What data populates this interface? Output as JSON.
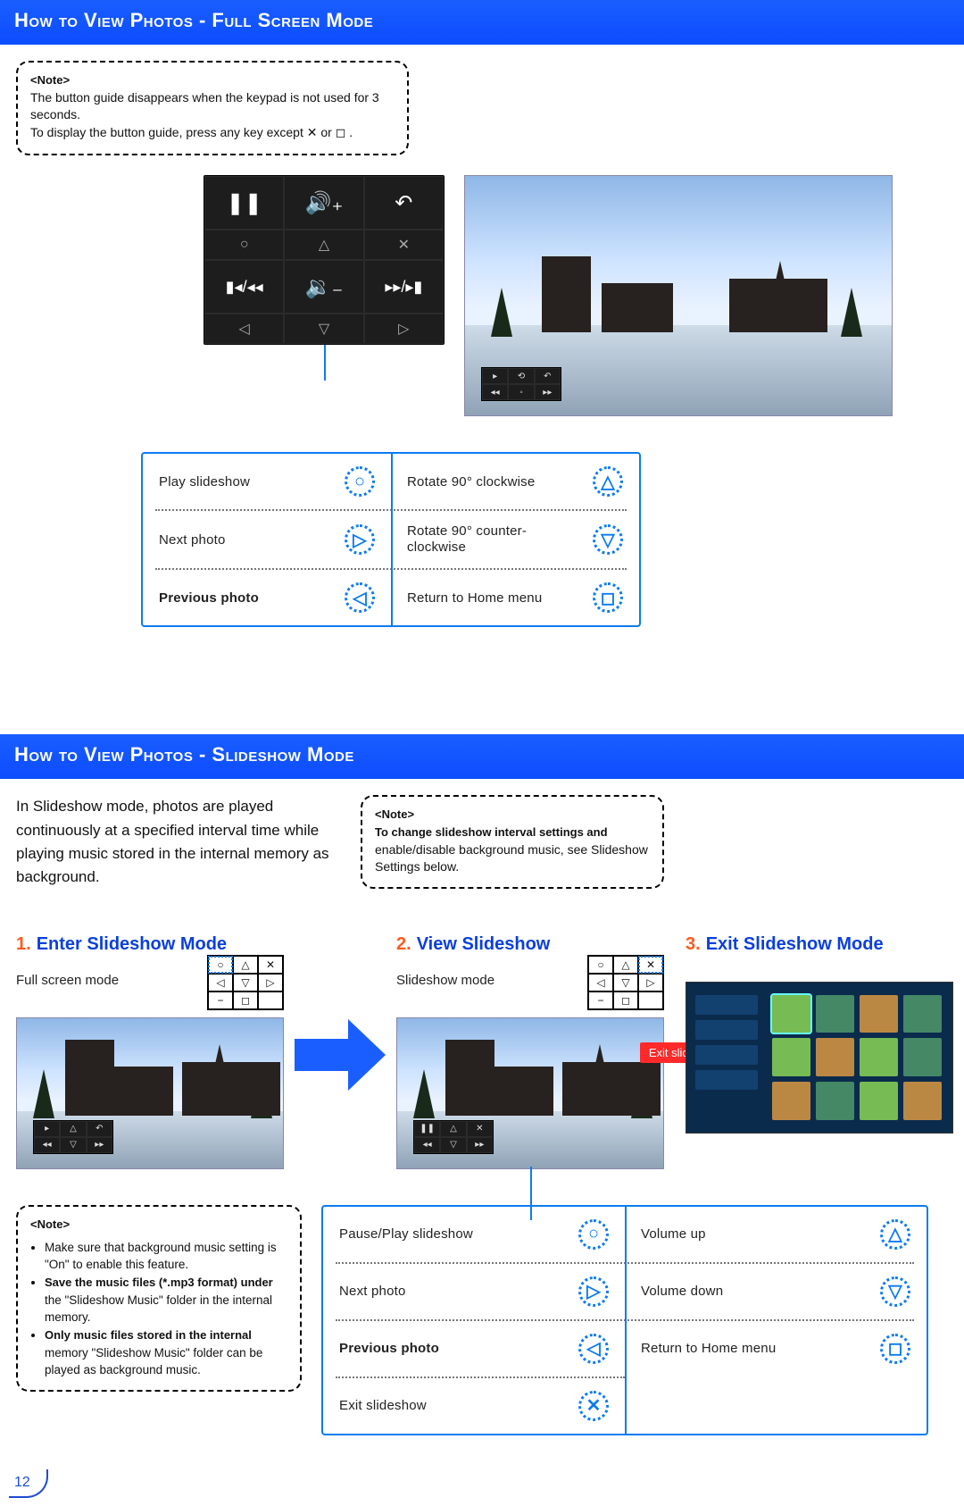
{
  "sections": {
    "fullscreen_title": "How to View Photos - Full Screen Mode",
    "slideshow_title": "How to View Photos - Slideshow Mode"
  },
  "note1": {
    "heading": "<Note>",
    "line1": "The button guide disappears when the keypad is not used for 3 seconds.",
    "line2_a": "To display the button guide, press any key except ",
    "line2_b": " or ",
    "line2_c": "."
  },
  "keypad_large": {
    "r1c1": "❚❚",
    "r1c2": "🔊₊",
    "r1c3": "↶",
    "r2c1": "○",
    "r2c2": "△",
    "r2c3": "✕",
    "r3c1": "▮◂/◂◂",
    "r3c2": "🔉₋",
    "r3c3": "▸▸/▸▮",
    "r4c1": "◁",
    "r4c2": "▽",
    "r4c3": "▷"
  },
  "legend_fullscreen": [
    {
      "label": "Play slideshow",
      "key": "○",
      "bold": false
    },
    {
      "label": "Rotate 90° clockwise",
      "key": "△",
      "bold": false
    },
    {
      "label": "Next photo",
      "key": "▷",
      "bold": false
    },
    {
      "label": "Rotate 90° counter-clockwise",
      "key": "▽",
      "bold": false
    },
    {
      "label": "Previous photo",
      "key": "◁",
      "bold": true
    },
    {
      "label": "Return to Home menu",
      "key": "◻",
      "bold": false
    }
  ],
  "slideshow_intro": "In Slideshow mode, photos are played continuously at a specified interval time while playing music stored in the internal memory as background.",
  "note2": {
    "heading": "<Note>",
    "line1": "To change slideshow interval settings and",
    "line2": "enable/disable background music, see Slideshow Settings below."
  },
  "steps": {
    "s1_title": "Enter Slideshow Mode",
    "s1_sub": "Full screen mode",
    "s2_title": "View Slideshow",
    "s2_sub": "Slideshow mode",
    "s3_title": "Exit Slideshow Mode",
    "exit_label": "Exit slideshow"
  },
  "note3": {
    "heading": "<Note>",
    "b1": "Make sure that background music setting is \"On\" to enable this feature.",
    "b2a": "Save the music files (*.mp3 format) under",
    "b2b": "the \"Slideshow Music\" folder in the internal memory.",
    "b3a": "Only music files stored in the internal",
    "b3b": "memory \"Slideshow Music\" folder can be played as background music."
  },
  "legend_slideshow_left": [
    {
      "label": "Pause/Play slideshow",
      "key": "○",
      "bold": false
    },
    {
      "label": "Next photo",
      "key": "▷",
      "bold": false
    },
    {
      "label": "Previous photo",
      "key": "◁",
      "bold": true
    },
    {
      "label": "Exit slideshow",
      "key": "✕",
      "bold": false
    }
  ],
  "legend_slideshow_right": [
    {
      "label": "Volume up",
      "key": "△",
      "bold": false
    },
    {
      "label": "Volume down",
      "key": "▽",
      "bold": false
    },
    {
      "label": "Return to Home menu",
      "key": "◻",
      "bold": false
    }
  ],
  "page_number": "12"
}
